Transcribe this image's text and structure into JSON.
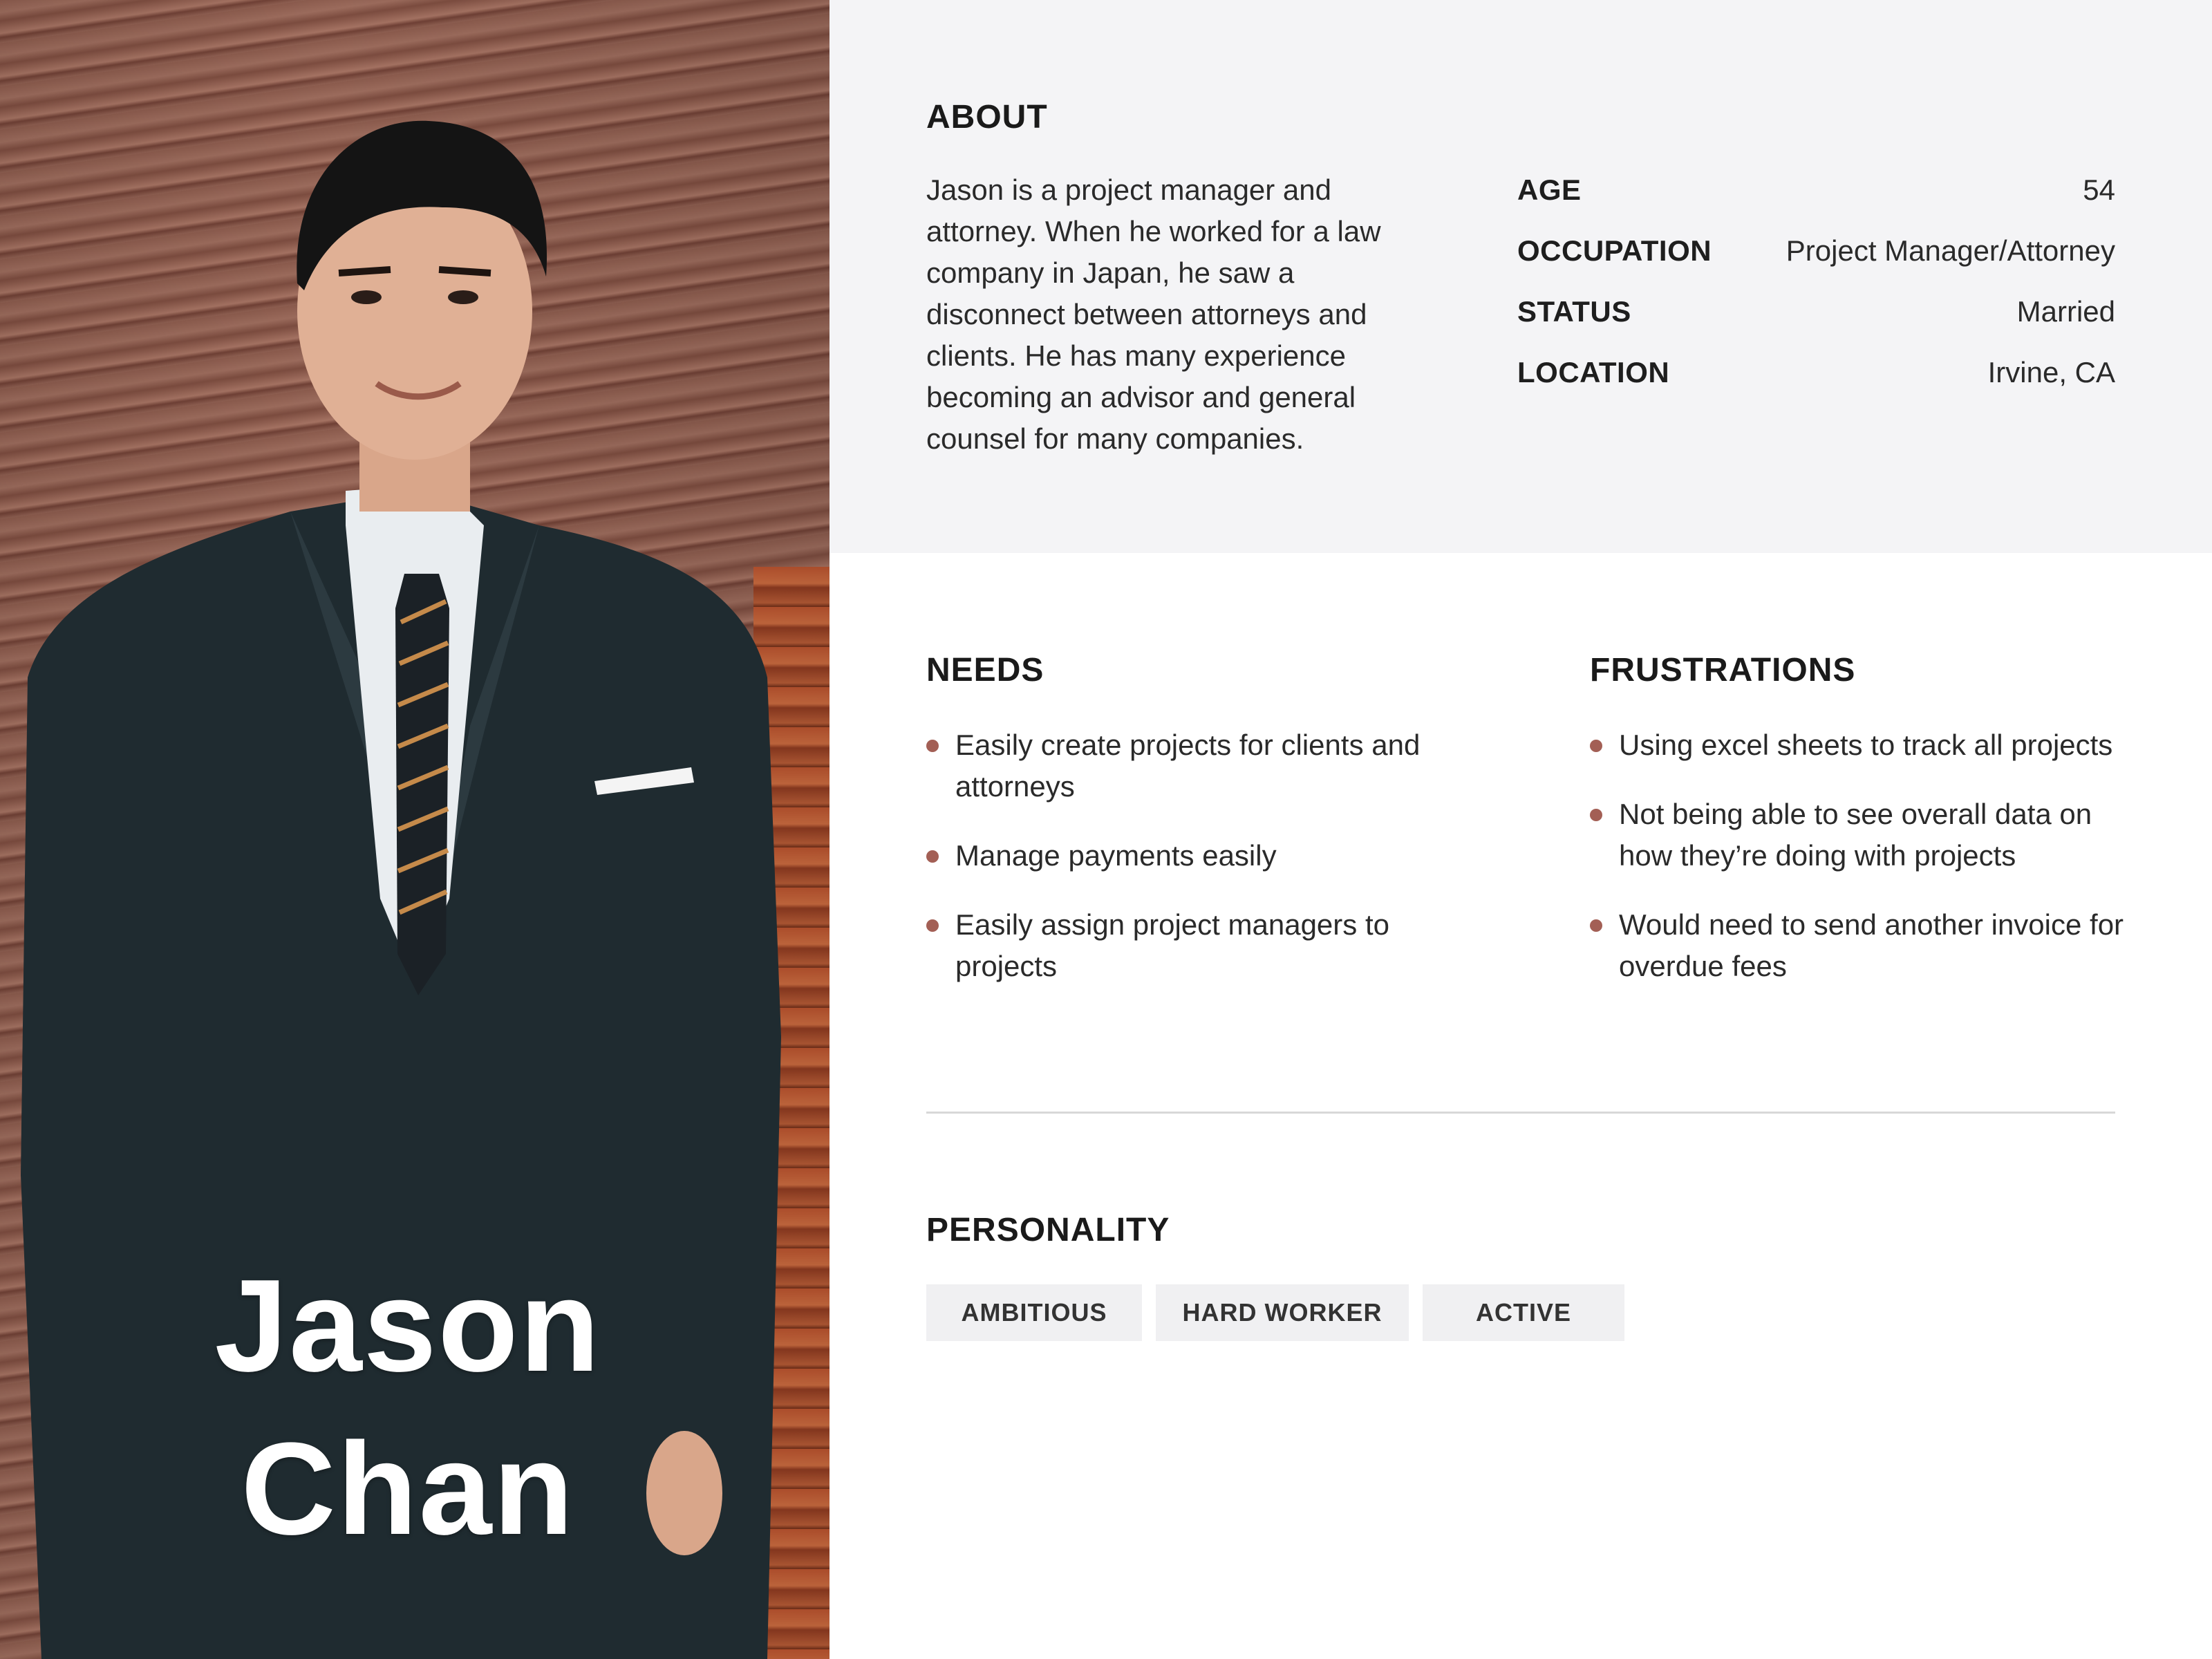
{
  "persona": {
    "first_name": "Jason",
    "last_name": "Chan"
  },
  "about": {
    "title": "ABOUT",
    "text": "Jason is a project manager and attorney. When he worked for a law company in Japan, he saw a disconnect between attorneys and clients. He has many experience becoming an advisor and general counsel for many companies.",
    "facts": [
      {
        "label": "AGE",
        "value": "54"
      },
      {
        "label": "OCCUPATION",
        "value": "Project Manager/Attorney"
      },
      {
        "label": "STATUS",
        "value": "Married"
      },
      {
        "label": "LOCATION",
        "value": "Irvine, CA"
      }
    ]
  },
  "needs": {
    "title": "NEEDS",
    "items": [
      "Easily create projects for clients and attorneys",
      "Manage payments easily",
      "Easily assign project managers to projects"
    ]
  },
  "frustrations": {
    "title": "FRUSTRATIONS",
    "items": [
      "Using excel sheets to track all projects",
      "Not being able to see overall data on how they’re doing with projects",
      "Would need to send another invoice for overdue fees"
    ]
  },
  "personality": {
    "title": "PERSONALITY",
    "tags": [
      "AMBITIOUS",
      "HARD WORKER",
      "ACTIVE"
    ]
  },
  "colors": {
    "accent": "#a35f55",
    "about_background": "#f4f4f6",
    "tag_background": "#f0f0f2"
  }
}
